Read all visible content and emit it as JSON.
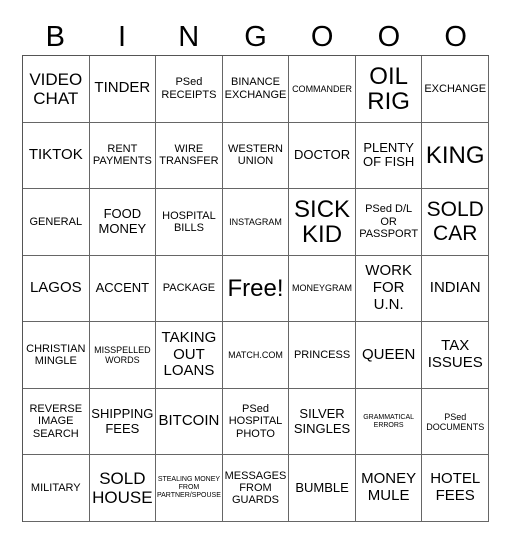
{
  "header": [
    "B",
    "I",
    "N",
    "G",
    "O",
    "O",
    "O"
  ],
  "rows": [
    [
      {
        "text": "VIDEO CHAT",
        "size": "s6"
      },
      {
        "text": "TINDER",
        "size": "s5"
      },
      {
        "text": "PSed RECEIPTS",
        "size": "s3"
      },
      {
        "text": "BINANCE EXCHANGE",
        "size": "s3"
      },
      {
        "text": "COMMANDER",
        "size": "s2"
      },
      {
        "text": "OIL RIG",
        "size": "s8"
      },
      {
        "text": "EXCHANGE",
        "size": "s3"
      }
    ],
    [
      {
        "text": "TIKTOK",
        "size": "s5"
      },
      {
        "text": "RENT PAYMENTS",
        "size": "s3"
      },
      {
        "text": "WIRE TRANSFER",
        "size": "s3"
      },
      {
        "text": "WESTERN UNION",
        "size": "s3"
      },
      {
        "text": "DOCTOR",
        "size": "s4"
      },
      {
        "text": "PLENTY OF FISH",
        "size": "s4"
      },
      {
        "text": "KING",
        "size": "s8"
      }
    ],
    [
      {
        "text": "GENERAL",
        "size": "s3"
      },
      {
        "text": "FOOD MONEY",
        "size": "s4"
      },
      {
        "text": "HOSPITAL BILLS",
        "size": "s3"
      },
      {
        "text": "INSTAGRAM",
        "size": "s2"
      },
      {
        "text": "SICK KID",
        "size": "s8"
      },
      {
        "text": "PSed D/L OR PASSPORT",
        "size": "s3"
      },
      {
        "text": "SOLD CAR",
        "size": "s7"
      }
    ],
    [
      {
        "text": "LAGOS",
        "size": "s5"
      },
      {
        "text": "ACCENT",
        "size": "s4"
      },
      {
        "text": "PACKAGE",
        "size": "s3"
      },
      {
        "text": "Free!",
        "size": "s8"
      },
      {
        "text": "MONEYGRAM",
        "size": "s2"
      },
      {
        "text": "WORK FOR U.N.",
        "size": "s5"
      },
      {
        "text": "INDIAN",
        "size": "s5"
      }
    ],
    [
      {
        "text": "CHRISTIAN MINGLE",
        "size": "s3"
      },
      {
        "text": "MISSPELLED WORDS",
        "size": "s2"
      },
      {
        "text": "TAKING OUT LOANS",
        "size": "s5"
      },
      {
        "text": "MATCH.COM",
        "size": "s2"
      },
      {
        "text": "PRINCESS",
        "size": "s3"
      },
      {
        "text": "QUEEN",
        "size": "s5"
      },
      {
        "text": "TAX ISSUES",
        "size": "s5"
      }
    ],
    [
      {
        "text": "REVERSE IMAGE SEARCH",
        "size": "s3"
      },
      {
        "text": "SHIPPING FEES",
        "size": "s4"
      },
      {
        "text": "BITCOIN",
        "size": "s5"
      },
      {
        "text": "PSed HOSPITAL PHOTO",
        "size": "s3"
      },
      {
        "text": "SILVER SINGLES",
        "size": "s4"
      },
      {
        "text": "GRAMMATICAL ERRORS",
        "size": "s1"
      },
      {
        "text": "PSed DOCUMENTS",
        "size": "s2"
      }
    ],
    [
      {
        "text": "MILITARY",
        "size": "s3"
      },
      {
        "text": "SOLD HOUSE",
        "size": "s6"
      },
      {
        "text": "STEALING MONEY FROM PARTNER/SPOUSE",
        "size": "s1"
      },
      {
        "text": "MESSAGES FROM GUARDS",
        "size": "s3"
      },
      {
        "text": "BUMBLE",
        "size": "s4"
      },
      {
        "text": "MONEY MULE",
        "size": "s5"
      },
      {
        "text": "HOTEL FEES",
        "size": "s5"
      }
    ]
  ]
}
